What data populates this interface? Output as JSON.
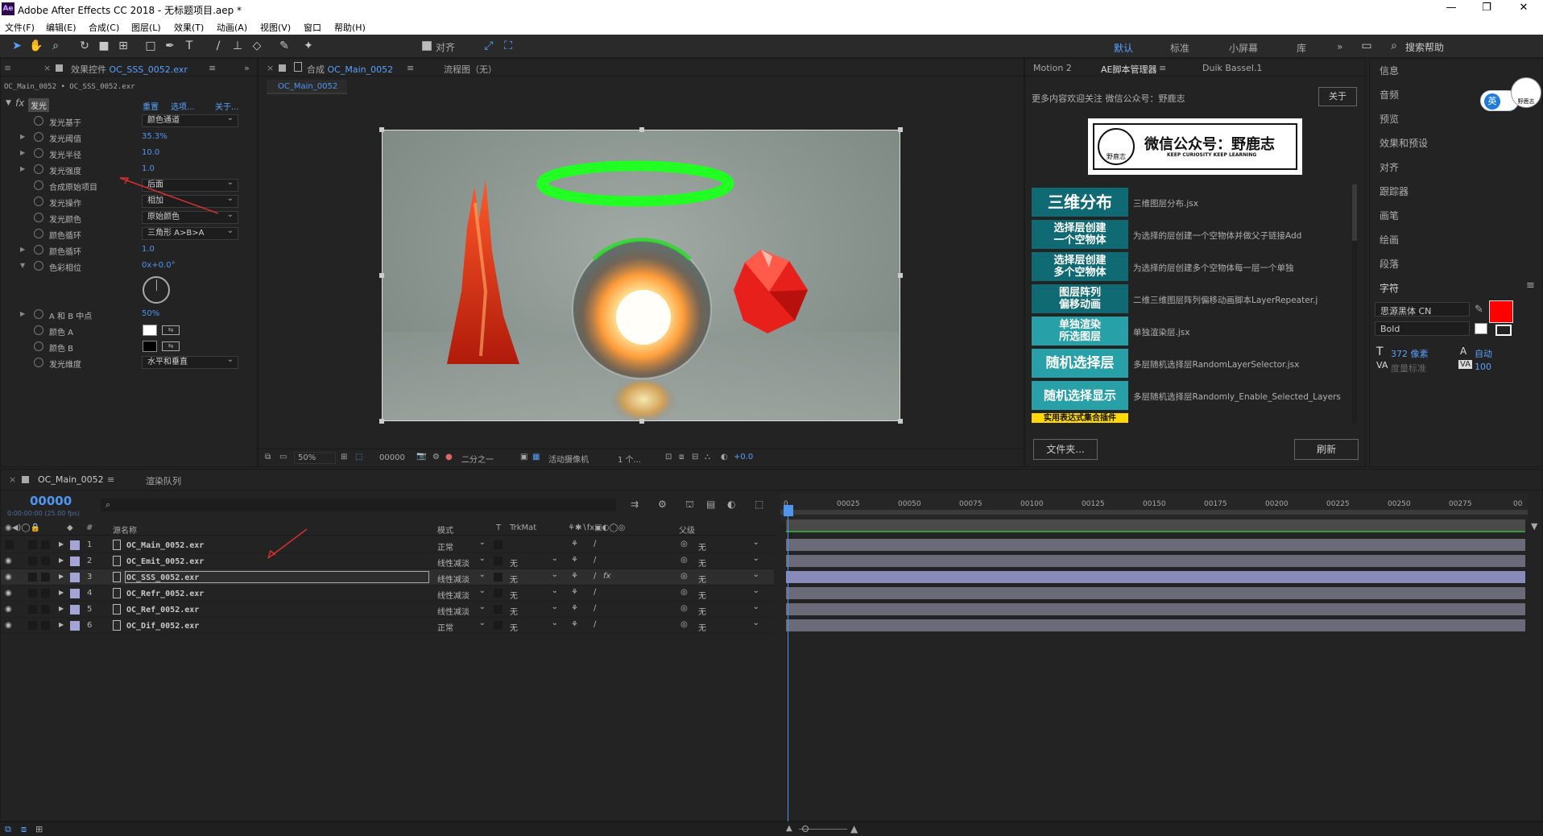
{
  "window": {
    "title": "Adobe After Effects CC 2018 - 无标题项目.aep *",
    "logo": "Ae"
  },
  "menu": [
    "文件(F)",
    "编辑(E)",
    "合成(C)",
    "图层(L)",
    "效果(T)",
    "动画(A)",
    "视图(V)",
    "窗口",
    "帮助(H)"
  ],
  "toolbar": {
    "snap_label": "对齐"
  },
  "workspaces": {
    "items": [
      "默认",
      "标准",
      "小屏幕",
      "库"
    ],
    "active": "默认",
    "more": "»",
    "search_placeholder": "搜索帮助"
  },
  "effects_panel": {
    "tab_label": "效果控件",
    "tab_file": "OC_SSS_0052.exr",
    "breadcrumb": "OC_Main_0052 • OC_SSS_0052.exr",
    "effect_name": "发光",
    "effect_links": [
      "重置",
      "选项...",
      "关于..."
    ],
    "props": [
      {
        "name": "发光基于",
        "dropdown": "颜色通道"
      },
      {
        "name": "发光阈值",
        "value": "35.3%"
      },
      {
        "name": "发光半径",
        "value": "10.0"
      },
      {
        "name": "发光强度",
        "value": "1.0"
      },
      {
        "name": "合成原始项目",
        "dropdown": "后面"
      },
      {
        "name": "发光操作",
        "dropdown": "相加"
      },
      {
        "name": "发光颜色",
        "dropdown": "原始颜色"
      },
      {
        "name": "颜色循环",
        "dropdown": "三角形 A>B>A"
      },
      {
        "name": "颜色循环",
        "value": "1.0"
      },
      {
        "name": "色彩相位",
        "value": "0x+0.0°"
      },
      {
        "name": "A 和 B 中点",
        "value": "50%"
      },
      {
        "name": "颜色 A",
        "color": "#ffffff"
      },
      {
        "name": "颜色 B",
        "color": "#000000"
      },
      {
        "name": "发光维度",
        "dropdown": "水平和垂直"
      }
    ]
  },
  "comp_panel": {
    "tab_label": "合成",
    "tab_comp": "OC_Main_0052",
    "flow_label": "流程图（无）",
    "subtab": "OC_Main_0052",
    "footer": {
      "zoom": "50%",
      "timecode": "00000",
      "resolution": "二分之一",
      "camera": "活动摄像机",
      "views": "1 个...",
      "exposure": "+0.0"
    }
  },
  "script_panel": {
    "tabs": [
      "Motion 2",
      "AE脚本管理器",
      "Duik Bassel.1"
    ],
    "active_tab": "AE脚本管理器",
    "notice": "更多内容欢迎关注 微信公众号：野鹿志",
    "about_btn": "关于",
    "banner_title": "微信公众号：野鹿志",
    "banner_sub": "KEEP CURIOSITY KEEP LEARNING",
    "banner_logo_text": "野鹿志",
    "scripts": [
      {
        "label": "三维分布",
        "desc": "三维图层分布.jsx",
        "color": "#0f6a73"
      },
      {
        "label": "选择层创建\n一个空物体",
        "desc": "为选择的层创建一个空物体并做父子链接Add",
        "color": "#0f6a73"
      },
      {
        "label": "选择层创建\n多个空物体",
        "desc": "为选择的层创建多个空物体每一层一个单独",
        "color": "#0f6a73"
      },
      {
        "label": "图层阵列\n偏移动画",
        "desc": "二维三维图层阵列偏移动画脚本LayerRepeater.j",
        "color": "#0f6a73"
      },
      {
        "label": "单独渲染\n所选图层",
        "desc": "单独渲染层.jsx",
        "color": "#27a0a8"
      },
      {
        "label": "随机选择层",
        "desc": "多层随机选择层RandomLayerSelector.jsx",
        "color": "#27a0a8"
      },
      {
        "label": "随机选择显示",
        "desc": "多层随机选择层Randomly_Enable_Selected_Layers",
        "color": "#27a0a8"
      }
    ],
    "partial_script_label": "实用表达式集合插件",
    "folder_btn": "文件夹...",
    "refresh_btn": "刷新"
  },
  "right_panel": {
    "items": [
      "信息",
      "音频",
      "预览",
      "效果和预设",
      "对齐",
      "跟踪器",
      "画笔",
      "绘画",
      "段落",
      "字符"
    ],
    "font": "思源黑体 CN",
    "style": "Bold",
    "size": "372 像素",
    "leading": "自动",
    "kerning": "度量标准",
    "tracking": "100",
    "fill_color": "#ff0000",
    "ime_badge": "英",
    "ime_logo": "野鹿志"
  },
  "timeline": {
    "tab_label": "OC_Main_0052",
    "render_queue": "渲染队列",
    "timecode": "00000",
    "timecode_sub": "0:00:00:00 (25.00 fps)",
    "columns": {
      "source": "源名称",
      "mode": "模式",
      "t": "T",
      "trkmat": "TrkMat",
      "parent": "父级"
    },
    "ruler": [
      "0",
      "00025",
      "00050",
      "00075",
      "00100",
      "00125",
      "00150",
      "00175",
      "00200",
      "00225",
      "00250",
      "00275",
      "00"
    ],
    "layers": [
      {
        "num": "1",
        "name": "OC_Main_0052.exr",
        "mode": "正常",
        "trkmat": "",
        "parent": "无"
      },
      {
        "num": "2",
        "name": "OC_Emit_0052.exr",
        "mode": "线性减淡",
        "trkmat": "无",
        "parent": "无"
      },
      {
        "num": "3",
        "name": "OC_SSS_0052.exr",
        "mode": "线性减淡",
        "trkmat": "无",
        "parent": "无",
        "fx": "fx"
      },
      {
        "num": "4",
        "name": "OC_Refr_0052.exr",
        "mode": "线性减淡",
        "trkmat": "无",
        "parent": "无"
      },
      {
        "num": "5",
        "name": "OC_Ref_0052.exr",
        "mode": "线性减淡",
        "trkmat": "无",
        "parent": "无"
      },
      {
        "num": "6",
        "name": "OC_Dif_0052.exr",
        "mode": "正常",
        "trkmat": "无",
        "parent": "无"
      }
    ]
  }
}
